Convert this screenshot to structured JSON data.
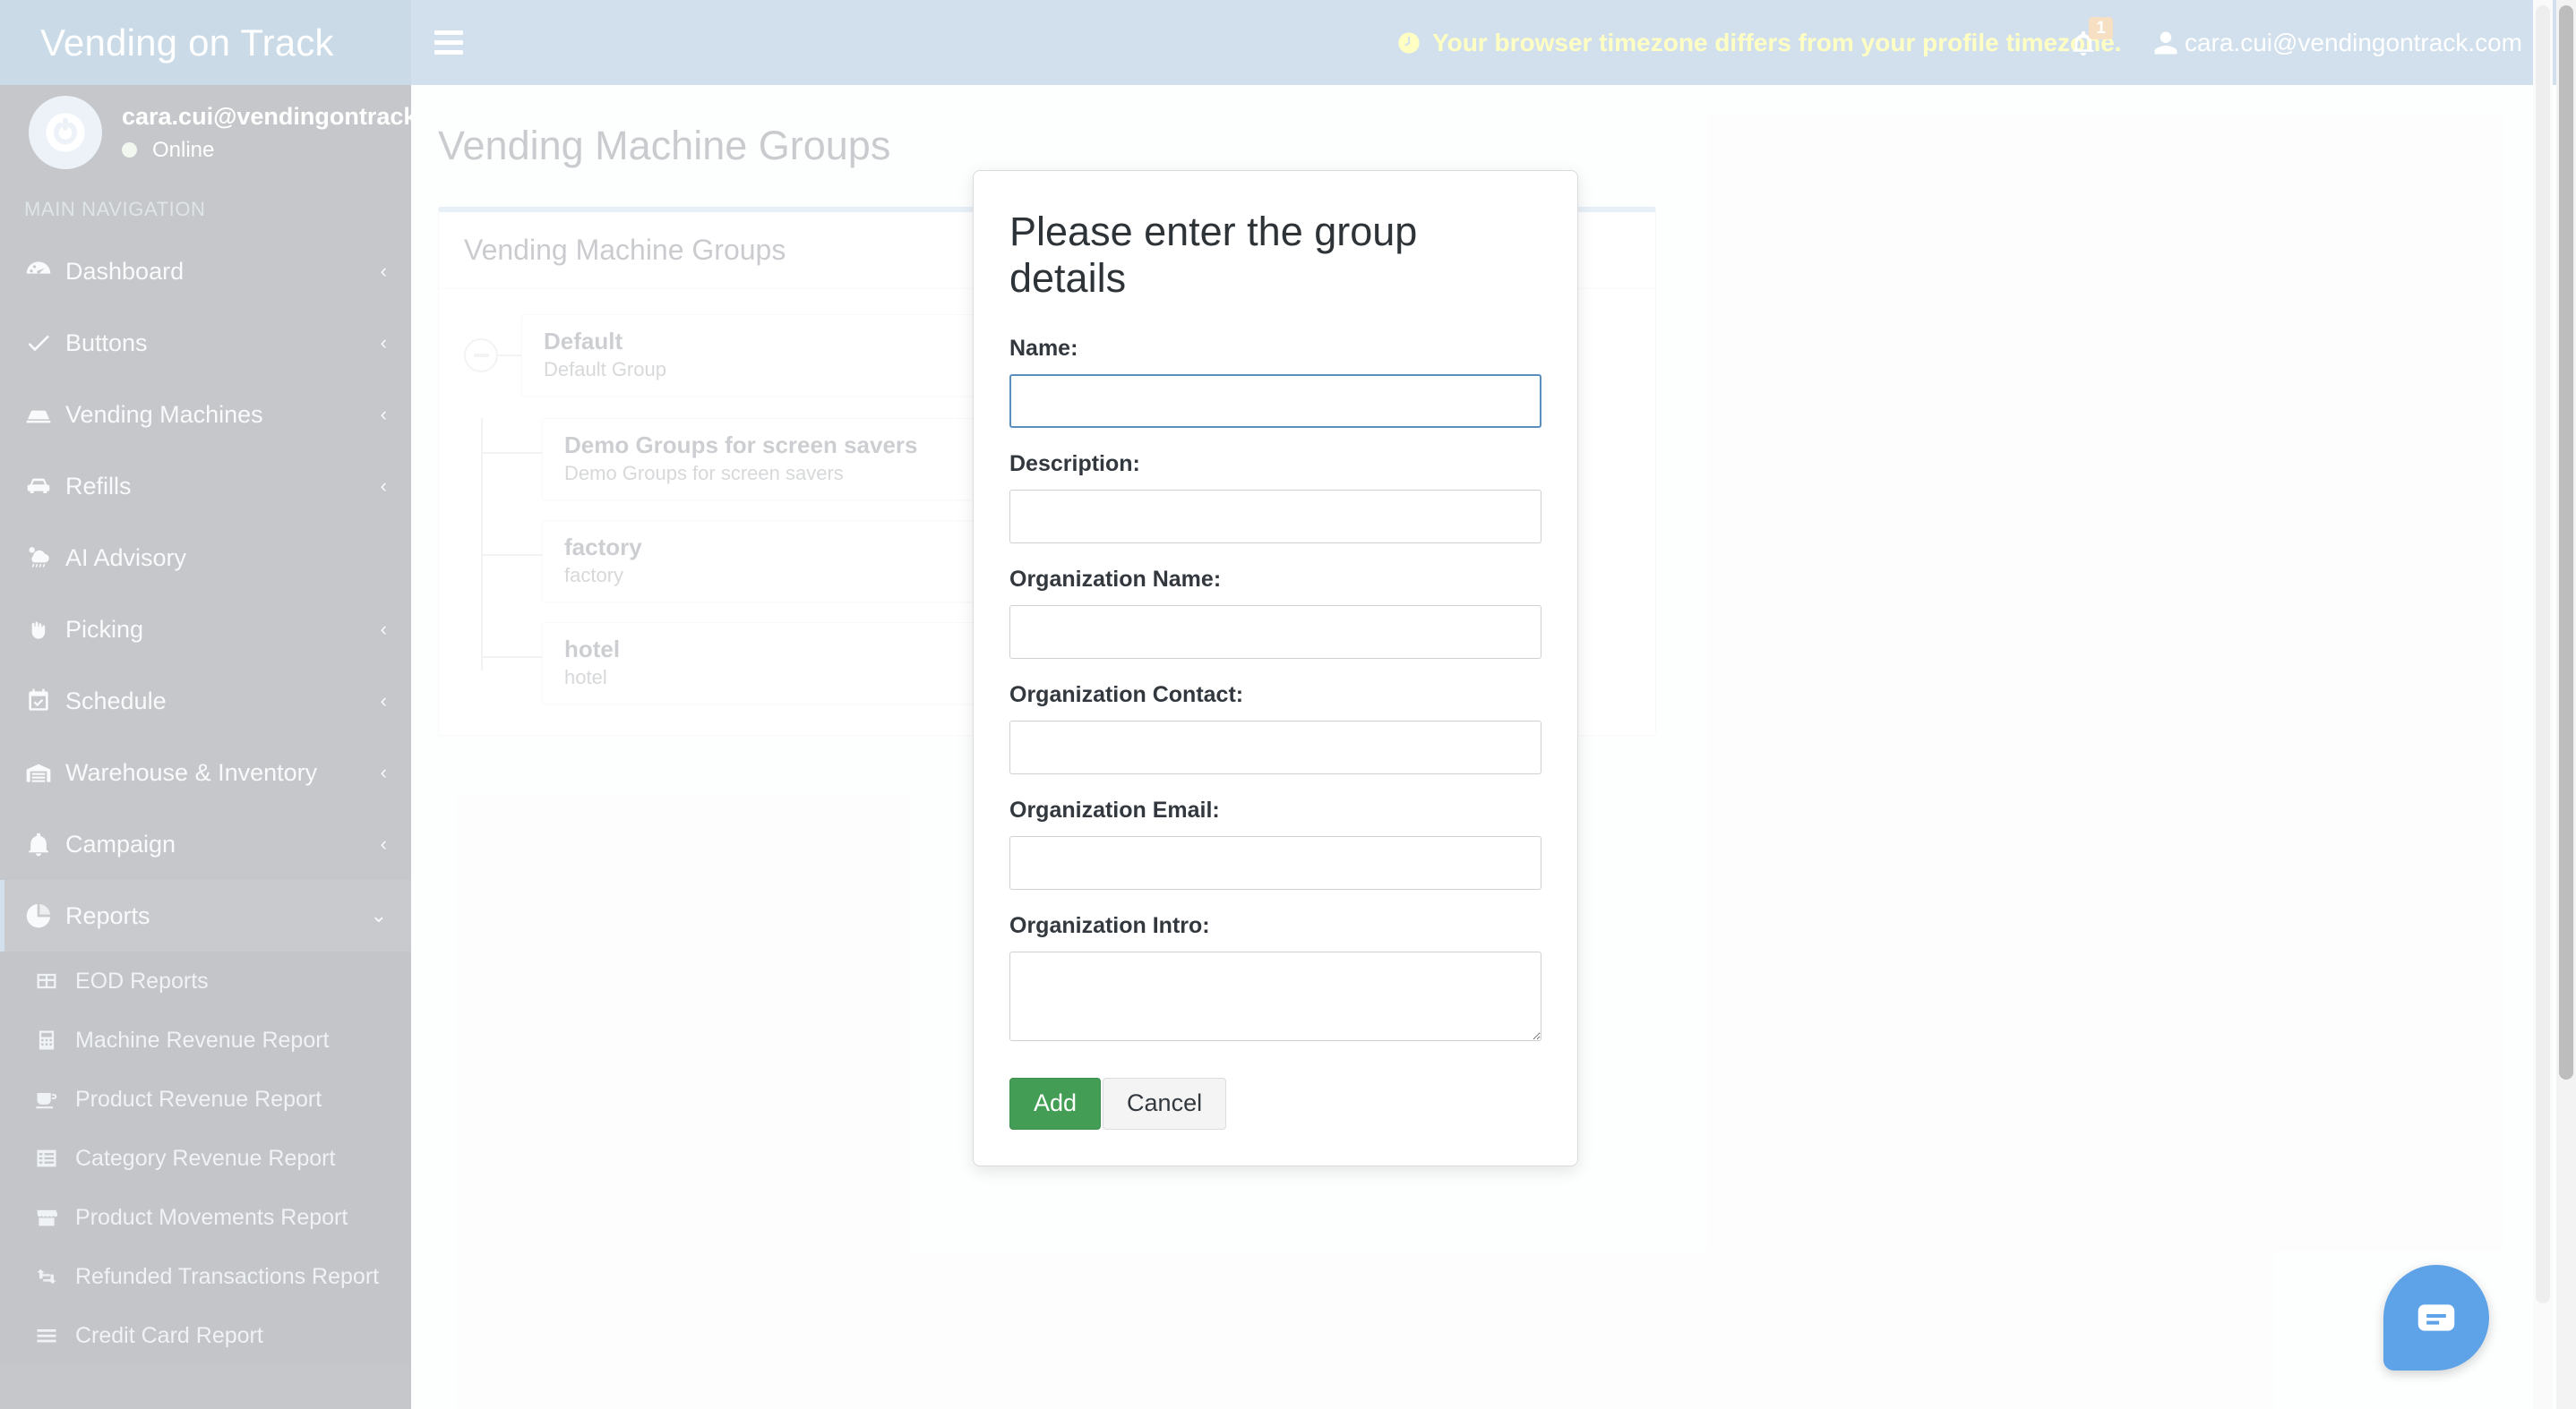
{
  "brand": {
    "name": "Vending on Track",
    "logo_icon": "power-circle-icon"
  },
  "colors": {
    "sidebar_logo_blue": "#417aa5",
    "topnav_blue": "#5b8fbb",
    "warning_yellow": "#ffff2e",
    "badge_orange": "#e08e2b",
    "add_button_green": "#449d54",
    "chat_blue": "#5ea2e8",
    "panel_top_border": "#a9c8e0"
  },
  "user": {
    "email": "cara.cui@vendingontrack.com",
    "email_truncated": "cara.cui@vendingontrack.",
    "status": "Online"
  },
  "topnav": {
    "menu_toggle": "hamburger-icon",
    "timezone_warning": "Your browser timezone differs from your profile timezone.",
    "notification_count": "1"
  },
  "sidebar": {
    "section_header": "MAIN NAVIGATION",
    "items": [
      {
        "label": "Dashboard",
        "icon": "dashboard-icon",
        "chevron": "‹",
        "active": false
      },
      {
        "label": "Buttons",
        "icon": "check-icon",
        "chevron": "‹",
        "active": false
      },
      {
        "label": "Vending Machines",
        "icon": "vending-machine-icon",
        "chevron": "‹",
        "active": false
      },
      {
        "label": "Refills",
        "icon": "car-icon",
        "chevron": "‹",
        "active": false
      },
      {
        "label": "AI Advisory",
        "icon": "weather-cloud-icon",
        "chevron": "",
        "active": false
      },
      {
        "label": "Picking",
        "icon": "hand-grab-icon",
        "chevron": "‹",
        "active": false
      },
      {
        "label": "Schedule",
        "icon": "calendar-check-icon",
        "chevron": "‹",
        "active": false
      },
      {
        "label": "Warehouse & Inventory",
        "icon": "warehouse-icon",
        "chevron": "‹",
        "active": false
      },
      {
        "label": "Campaign",
        "icon": "bell-icon",
        "chevron": "‹",
        "active": false
      },
      {
        "label": "Reports",
        "icon": "pie-chart-icon",
        "chevron": "⌄",
        "active": true
      }
    ],
    "reports_subitems": [
      {
        "label": "EOD Reports",
        "icon": "table-icon"
      },
      {
        "label": "Machine Revenue Report",
        "icon": "calculator-icon"
      },
      {
        "label": "Product Revenue Report",
        "icon": "coffee-icon"
      },
      {
        "label": "Category Revenue Report",
        "icon": "list-icon"
      },
      {
        "label": "Product Movements Report",
        "icon": "store-icon"
      },
      {
        "label": "Refunded Transactions Report",
        "icon": "retweet-icon"
      },
      {
        "label": "Credit Card Report",
        "icon": "bars-icon"
      }
    ]
  },
  "page": {
    "title": "Vending Machine Groups",
    "panel_heading": "Vending Machine Groups"
  },
  "tree": {
    "root": {
      "name": "Default",
      "description": "Default Group",
      "toggle": "collapse-minus-icon"
    },
    "children": [
      {
        "name": "Demo Groups for screen savers",
        "description": "Demo Groups for screen savers"
      },
      {
        "name": "factory",
        "description": "factory"
      },
      {
        "name": "hotel",
        "description": "hotel"
      }
    ]
  },
  "modal": {
    "title": "Please enter the group details",
    "fields": [
      {
        "label": "Name:",
        "value": "",
        "placeholder": "",
        "type": "text",
        "focused": true
      },
      {
        "label": "Description:",
        "value": "",
        "placeholder": "",
        "type": "text",
        "focused": false
      },
      {
        "label": "Organization Name:",
        "value": "",
        "placeholder": "",
        "type": "text",
        "focused": false
      },
      {
        "label": "Organization Contact:",
        "value": "",
        "placeholder": "",
        "type": "text",
        "focused": false
      },
      {
        "label": "Organization Email:",
        "value": "",
        "placeholder": "",
        "type": "text",
        "focused": false
      },
      {
        "label": "Organization Intro:",
        "value": "",
        "placeholder": "",
        "type": "textarea",
        "focused": false
      }
    ],
    "add_label": "Add",
    "cancel_label": "Cancel"
  },
  "chat_widget": {
    "icon": "chat-bubble-icon"
  }
}
